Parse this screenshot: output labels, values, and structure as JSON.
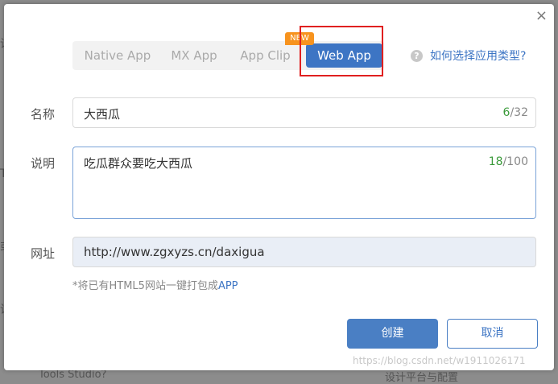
{
  "background": {
    "fragments": [
      "设",
      "TI",
      "或",
      "试",
      "Tools Studio?",
      "设计平台与配置"
    ]
  },
  "dialog": {
    "close_glyph": "×",
    "tabs": [
      {
        "label": "Native App",
        "active": false
      },
      {
        "label": "MX App",
        "active": false
      },
      {
        "label": "App Clip",
        "active": false
      },
      {
        "label": "Web App",
        "active": true
      }
    ],
    "new_badge": "NEW",
    "help_icon": "question-circle-icon",
    "help_link": "如何选择应用类型?",
    "name_field": {
      "label": "名称",
      "value": "大西瓜",
      "count_current": "6",
      "count_max": "/32"
    },
    "desc_field": {
      "label": "说明",
      "value": "吃瓜群众要吃大西瓜",
      "count_current": "18",
      "count_max": "/100"
    },
    "url_field": {
      "label": "网址",
      "value": "http://www.zgxyzs.cn/daxigua"
    },
    "hint_text": "*将已有HTML5网站一键打包成",
    "hint_app": "APP",
    "create_button": "创建",
    "cancel_button": "取消"
  },
  "watermark": "https://blog.csdn.net/w1911026171",
  "colors": {
    "accent": "#3d75c4",
    "badge": "#f7931e",
    "counter": "#3a9a3a",
    "highlight": "#e02020"
  }
}
